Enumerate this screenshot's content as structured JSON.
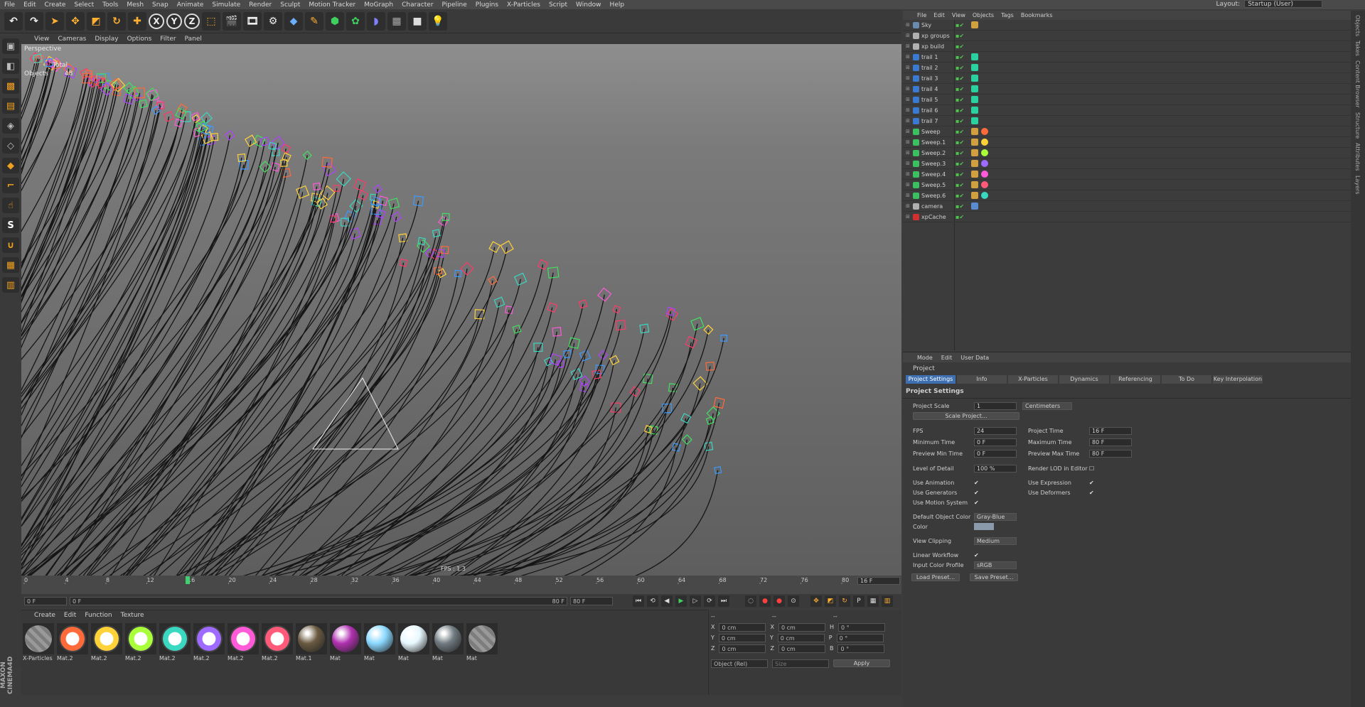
{
  "menubar": {
    "items": [
      "File",
      "Edit",
      "Create",
      "Select",
      "Tools",
      "Mesh",
      "Snap",
      "Animate",
      "Simulate",
      "Render",
      "Sculpt",
      "Motion Tracker",
      "MoGraph",
      "Character",
      "Pipeline",
      "Plugins",
      "X-Particles",
      "Script",
      "Window",
      "Help"
    ],
    "layout_label": "Layout:",
    "layout_value": "Startup (User)"
  },
  "toolbar": {
    "axis": [
      "X",
      "Y",
      "Z"
    ]
  },
  "viewport": {
    "menu": [
      "View",
      "Cameras",
      "Display",
      "Options",
      "Filter",
      "Panel"
    ],
    "label": "Perspective",
    "stats_total": "Total",
    "stats_objects": "Objects",
    "stats_objects_val": "48",
    "fps": "FPS : 1.3"
  },
  "timeline": {
    "ticks": [
      "0",
      "4",
      "8",
      "12",
      "16",
      "20",
      "24",
      "28",
      "32",
      "36",
      "40",
      "44",
      "48",
      "52",
      "56",
      "60",
      "64",
      "68",
      "72",
      "76",
      "80"
    ],
    "current": "16 F",
    "playhead": 16,
    "end": 80
  },
  "transport": {
    "start": "0 F",
    "range_start": "0 F",
    "range_end": "80 F",
    "end": "80 F"
  },
  "materials": {
    "menu": [
      "Create",
      "Edit",
      "Function",
      "Texture"
    ],
    "items": [
      {
        "name": "X-Particles",
        "color": "#7d7d7d",
        "style": "stripe"
      },
      {
        "name": "Mat.2",
        "color": "#ff6a3a",
        "style": "ring"
      },
      {
        "name": "Mat.2",
        "color": "#ffd23a",
        "style": "ring"
      },
      {
        "name": "Mat.2",
        "color": "#a8ff3a",
        "style": "ring"
      },
      {
        "name": "Mat.2",
        "color": "#3ad8c0",
        "style": "ring"
      },
      {
        "name": "Mat.2",
        "color": "#9f6aff",
        "style": "ring"
      },
      {
        "name": "Mat.2",
        "color": "#ff5ad8",
        "style": "ring"
      },
      {
        "name": "Mat.2",
        "color": "#ff5a7a",
        "style": "ring"
      },
      {
        "name": "Mat.1",
        "color": "#6a5a40",
        "style": "solid"
      },
      {
        "name": "Mat",
        "color": "#b030b0",
        "style": "solid"
      },
      {
        "name": "Mat",
        "color": "#8ad8ff",
        "style": "solid"
      },
      {
        "name": "Mat",
        "color": "#e8f8ff",
        "style": "solid"
      },
      {
        "name": "Mat",
        "color": "#707a80",
        "style": "solid"
      },
      {
        "name": "Mat",
        "color": "#7d7d7d",
        "style": "stripe"
      }
    ]
  },
  "coords": {
    "rows": [
      {
        "a": "X",
        "av": "0 cm",
        "b": "X",
        "bv": "0 cm",
        "c": "H",
        "cv": "0 °"
      },
      {
        "a": "Y",
        "av": "0 cm",
        "b": "Y",
        "bv": "0 cm",
        "c": "P",
        "cv": "0 °"
      },
      {
        "a": "Z",
        "av": "0 cm",
        "b": "Z",
        "bv": "0 cm",
        "c": "B",
        "cv": "0 °"
      }
    ],
    "mode": "Object (Rel)",
    "size": "Size",
    "apply": "Apply"
  },
  "objects": {
    "menu": [
      "File",
      "Edit",
      "View",
      "Objects",
      "Tags",
      "Bookmarks"
    ],
    "items": [
      {
        "name": "Sky",
        "icon": "#6a8ab0",
        "tag": "#d0a040",
        "tag2": ""
      },
      {
        "name": "xp groups",
        "icon": "#b0b0b0",
        "tag": "",
        "tag2": ""
      },
      {
        "name": "xp build",
        "icon": "#b0b0b0",
        "tag": "",
        "tag2": ""
      },
      {
        "name": "trail 1",
        "icon": "#3a7ad0",
        "tag": "#2ad0a0",
        "tag2": ""
      },
      {
        "name": "trail 2",
        "icon": "#3a7ad0",
        "tag": "#2ad0a0",
        "tag2": ""
      },
      {
        "name": "trail 3",
        "icon": "#3a7ad0",
        "tag": "#2ad0a0",
        "tag2": ""
      },
      {
        "name": "trail 4",
        "icon": "#3a7ad0",
        "tag": "#2ad0a0",
        "tag2": ""
      },
      {
        "name": "trail 5",
        "icon": "#3a7ad0",
        "tag": "#2ad0a0",
        "tag2": ""
      },
      {
        "name": "trail 6",
        "icon": "#3a7ad0",
        "tag": "#2ad0a0",
        "tag2": ""
      },
      {
        "name": "trail 7",
        "icon": "#3a7ad0",
        "tag": "#2ad0a0",
        "tag2": ""
      },
      {
        "name": "Sweep",
        "icon": "#3ac060",
        "tag": "#d0a040",
        "tag2": "#ff6a3a"
      },
      {
        "name": "Sweep.1",
        "icon": "#3ac060",
        "tag": "#d0a040",
        "tag2": "#ffd23a"
      },
      {
        "name": "Sweep.2",
        "icon": "#3ac060",
        "tag": "#d0a040",
        "tag2": "#a8ff3a"
      },
      {
        "name": "Sweep.3",
        "icon": "#3ac060",
        "tag": "#d0a040",
        "tag2": "#9f6aff"
      },
      {
        "name": "Sweep.4",
        "icon": "#3ac060",
        "tag": "#d0a040",
        "tag2": "#ff5ad8"
      },
      {
        "name": "Sweep.5",
        "icon": "#3ac060",
        "tag": "#d0a040",
        "tag2": "#ff5a7a"
      },
      {
        "name": "Sweep.6",
        "icon": "#3ac060",
        "tag": "#d0a040",
        "tag2": "#3ad8c0"
      },
      {
        "name": "camera",
        "icon": "#b0b0b0",
        "tag": "#5a8ad0",
        "tag2": ""
      },
      {
        "name": "xpCache",
        "icon": "#d03030",
        "tag": "",
        "tag2": ""
      }
    ]
  },
  "attributes": {
    "menu": [
      "Mode",
      "Edit",
      "User Data"
    ],
    "title": "Project",
    "tabs": [
      "Project Settings",
      "Info",
      "X-Particles",
      "Dynamics",
      "Referencing",
      "To Do",
      "Key Interpolation"
    ],
    "section": "Project Settings",
    "project_scale_label": "Project Scale",
    "project_scale_val": "1",
    "project_scale_unit": "Centimeters",
    "scale_project_btn": "Scale Project...",
    "fps_label": "FPS",
    "fps_val": "24",
    "project_time_label": "Project Time",
    "project_time_val": "16 F",
    "min_time_label": "Minimum Time",
    "min_time_val": "0 F",
    "max_time_label": "Maximum Time",
    "max_time_val": "80 F",
    "prev_min_label": "Preview Min Time",
    "prev_min_val": "0 F",
    "prev_max_label": "Preview Max Time",
    "prev_max_val": "80 F",
    "lod_label": "Level of Detail",
    "lod_val": "100 %",
    "render_lod_label": "Render LOD in Editor",
    "use_anim_label": "Use Animation",
    "use_expr_label": "Use Expression",
    "use_gen_label": "Use Generators",
    "use_def_label": "Use Deformers",
    "use_motion_label": "Use Motion System",
    "def_color_label": "Default Object Color",
    "def_color_val": "Gray-Blue",
    "color_label": "Color",
    "clip_label": "View Clipping",
    "clip_val": "Medium",
    "linear_label": "Linear Workflow",
    "profile_label": "Input Color Profile",
    "profile_val": "sRGB",
    "load_btn": "Load Preset...",
    "save_btn": "Save Preset..."
  },
  "rightstrip": {
    "tabs": [
      "Objects",
      "Takes",
      "Content Browser",
      "Structure",
      "Attributes",
      "Layers"
    ]
  }
}
